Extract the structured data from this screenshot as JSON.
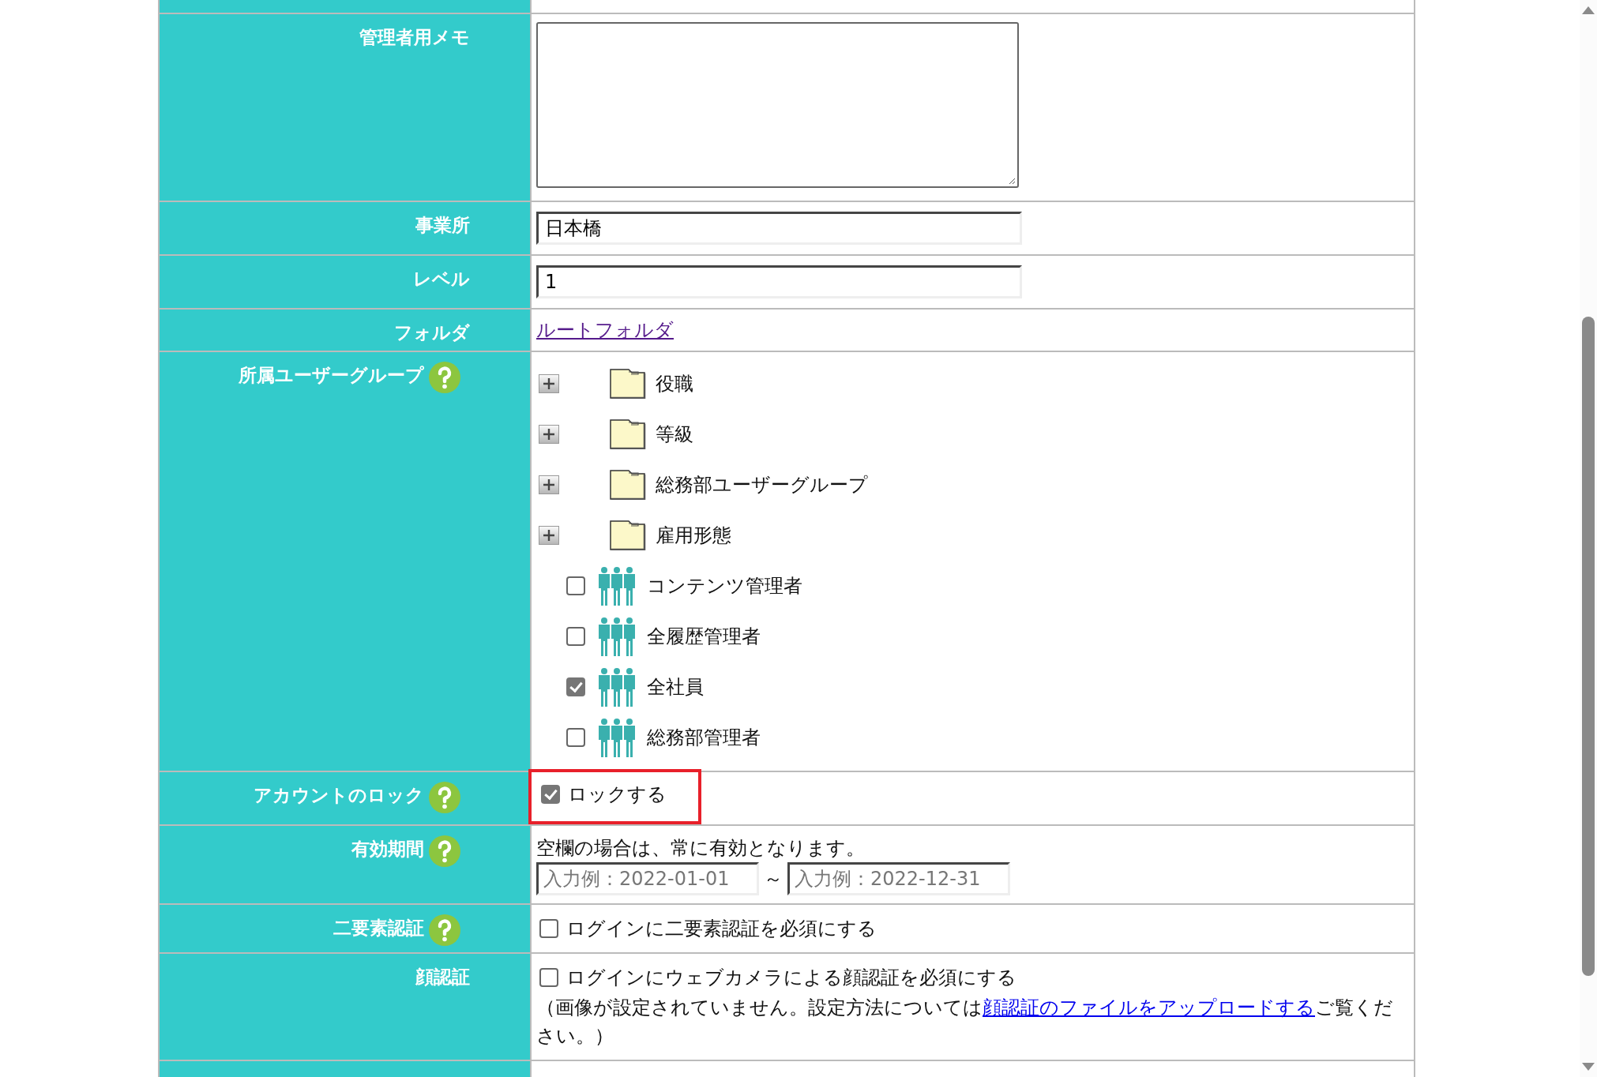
{
  "rows": [
    {
      "kind": "blank",
      "label": ""
    },
    {
      "kind": "textarea",
      "label": "管理者用メモ",
      "help": false
    },
    {
      "kind": "input",
      "label": "事業所",
      "help": false,
      "value": "日本橋"
    },
    {
      "kind": "input",
      "label": "レベル",
      "help": false,
      "value": "1"
    },
    {
      "kind": "link",
      "label": "フォルダ",
      "help": false,
      "link": "ルートフォルダ",
      "visited": true
    },
    {
      "kind": "tree",
      "label": "所属ユーザーグループ",
      "help": true,
      "items": [
        {
          "kind": "folder",
          "name": "役職",
          "expanded": false
        },
        {
          "kind": "folder",
          "name": "等級",
          "expanded": false
        },
        {
          "kind": "folder",
          "name": "総務部ユーザーグループ",
          "expanded": false
        },
        {
          "kind": "folder",
          "name": "雇用形態",
          "expanded": false
        },
        {
          "kind": "group",
          "name": "コンテンツ管理者",
          "checked": false
        },
        {
          "kind": "group",
          "name": "全履歴管理者",
          "checked": false
        },
        {
          "kind": "group",
          "name": "全社員",
          "checked": true
        },
        {
          "kind": "group",
          "name": "総務部管理者",
          "checked": false
        }
      ]
    },
    {
      "kind": "checkbox",
      "label": "アカウントのロック",
      "help": true,
      "text": "ロックする",
      "checked": true,
      "highlighted": true
    },
    {
      "kind": "date_range",
      "label": "有効期間",
      "help": true,
      "note": "空欄の場合は、常に有効となります。",
      "from_placeholder": "入力例：2022-01-01",
      "separator": "～",
      "to_placeholder": "入力例：2022-12-31"
    },
    {
      "kind": "checkbox",
      "label": "二要素認証",
      "help": true,
      "text": "ログインに二要素認証を必須にする",
      "checked": false,
      "highlighted": false
    },
    {
      "kind": "checkbox_note",
      "label": "顔認証",
      "help": false,
      "text": "ログインにウェブカメラによる顔認証を必須にする",
      "checked": false,
      "note_before": "（画像が設定されていません。設定方法については",
      "note_link": "顔認証のファイルをアップロードする",
      "note_after": "ご覧ください。）",
      "visited": false
    },
    {
      "kind": "blank",
      "label": ""
    }
  ]
}
